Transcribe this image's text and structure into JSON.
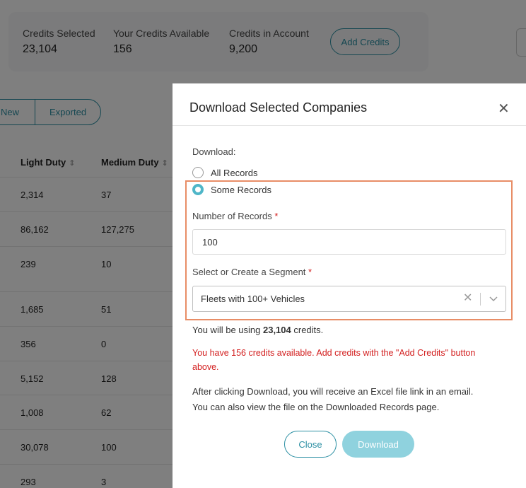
{
  "background": {
    "credits": [
      {
        "label": "Credits Selected",
        "value": "23,104"
      },
      {
        "label": "Your Credits Available",
        "value": "156"
      },
      {
        "label": "Credits in Account",
        "value": "9,200"
      }
    ],
    "add_credits_label": "Add Credits",
    "filters": [
      "New",
      "Exported"
    ],
    "columns": [
      "Light Duty",
      "Medium Duty"
    ],
    "rows": [
      [
        "2,314",
        "37"
      ],
      [
        "86,162",
        "127,275"
      ],
      [
        "239",
        "10"
      ],
      [
        "1,685",
        "51"
      ],
      [
        "356",
        "0"
      ],
      [
        "5,152",
        "128"
      ],
      [
        "1,008",
        "62"
      ],
      [
        "30,078",
        "100"
      ],
      [
        "293",
        "3"
      ]
    ]
  },
  "modal": {
    "title": "Download Selected Companies",
    "download_label": "Download:",
    "options": [
      "All Records",
      "Some Records"
    ],
    "selected_option": "Some Records",
    "num_records_label": "Number of Records",
    "num_records_value": "100",
    "segment_label": "Select or Create a Segment",
    "segment_value": "Fleets with 100+ Vehicles",
    "required_mark": "*",
    "usage_prefix": "You will be using ",
    "usage_amount": "23,104",
    "usage_suffix": " credits.",
    "warning": "You have 156 credits available. Add credits with the \"Add Credits\" button above.",
    "after_line1": "After clicking Download, you will receive an Excel file link in an email.",
    "after_line2": "You can also view the file on the Downloaded Records page.",
    "close_label": "Close",
    "download_button_label": "Download"
  },
  "colors": {
    "accent": "#2b8fa3",
    "radio_checked": "#4fb6c8",
    "download_disabled": "#8fd2de",
    "warning": "#d32020",
    "highlight_box": "#e88d66"
  }
}
